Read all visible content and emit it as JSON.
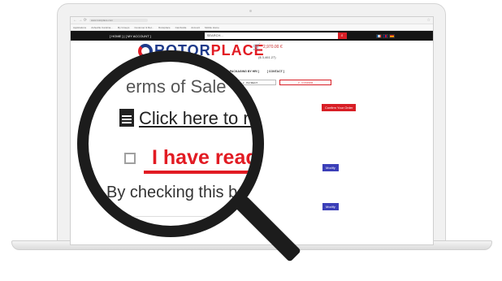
{
  "browser": {
    "nav": "← → ⟳",
    "address": "www.rotorplace.com",
    "bookmarks": [
      "Applications",
      "Asheville Carolina...",
      "My Groups",
      "Customer & Rel...",
      "Rotorplace",
      "Cambodia",
      "Account",
      "Mobile Home"
    ]
  },
  "topbar": {
    "links": "[ HOME ]   |   [ MY ACCOUNT ]",
    "search_placeholder": "SEARCH...",
    "search_icon": "search-icon",
    "flags": [
      "french-flag-icon",
      "uk-flag-icon",
      "spanish-flag-icon"
    ]
  },
  "brand": {
    "name_part1": "ROTOR",
    "name_part2": "PLACE",
    "sub": "by HRI",
    "colors": {
      "blue": "#1e3a8a",
      "red": "#e21b23"
    }
  },
  "cart": {
    "amount": "2,970.00 €",
    "usd": "($ 3,461.27)"
  },
  "menu": {
    "items": [
      "RI ]",
      "[ PRODUCTS ]",
      "[ WORLD CLASS PACKAGING BY HRI ]",
      "[ CONTACT ]"
    ]
  },
  "checkout": {
    "steps": [
      "1 - SHIPPING",
      "2 - PAYMENT",
      "3 - CONFIRM"
    ],
    "confirm_label": "Confirm Your Order",
    "modify_label": "Modify"
  },
  "zoomed": {
    "title": "erms of Sale",
    "link": "Click here to rea",
    "read_label": "I have read",
    "checking_text": "By checking this box, y"
  }
}
